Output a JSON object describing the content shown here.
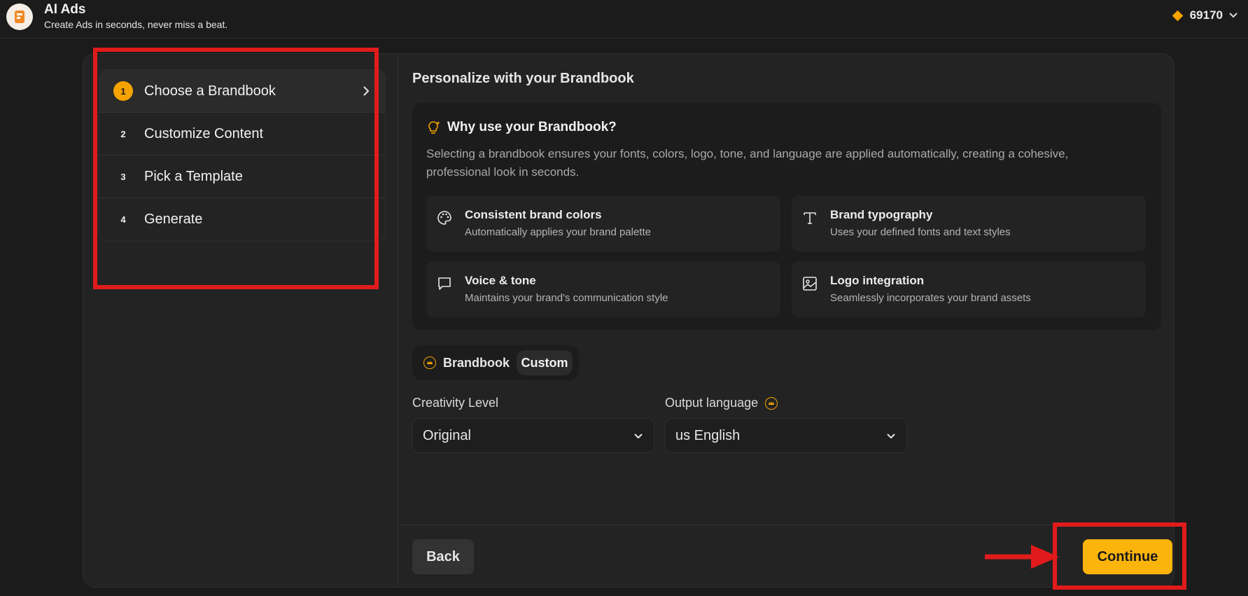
{
  "header": {
    "title": "AI Ads",
    "subtitle": "Create Ads in seconds, never miss a beat.",
    "credits": "69170"
  },
  "steps": [
    {
      "num": "1",
      "label": "Choose a Brandbook",
      "active": true
    },
    {
      "num": "2",
      "label": "Customize Content",
      "active": false
    },
    {
      "num": "3",
      "label": "Pick a Template",
      "active": false
    },
    {
      "num": "4",
      "label": "Generate",
      "active": false
    }
  ],
  "main": {
    "title": "Personalize with your Brandbook",
    "why": {
      "title": "Why use your Brandbook?",
      "text": "Selecting a brandbook ensures your fonts, colors, logo, tone, and language are applied automatically, creating a cohesive, professional look in seconds."
    },
    "features": [
      {
        "icon": "palette-icon",
        "title": "Consistent brand colors",
        "desc": "Automatically applies your brand palette"
      },
      {
        "icon": "typography-icon",
        "title": "Brand typography",
        "desc": "Uses your defined fonts and text styles"
      },
      {
        "icon": "chat-bubble-icon",
        "title": "Voice & tone",
        "desc": "Maintains your brand's communication style"
      },
      {
        "icon": "image-icon",
        "title": "Logo integration",
        "desc": "Seamlessly incorporates your brand assets"
      }
    ],
    "toggle": {
      "option_1": "Brandbook",
      "option_2": "Custom",
      "selected": "Custom"
    },
    "creativity": {
      "label": "Creativity Level",
      "value": "Original"
    },
    "language": {
      "label": "Output language",
      "value": "us English"
    }
  },
  "footer": {
    "back": "Back",
    "continue": "Continue"
  },
  "colors": {
    "accent": "#fbb40b",
    "annotation": "#e11b1b",
    "background": "#1b1b1b"
  }
}
